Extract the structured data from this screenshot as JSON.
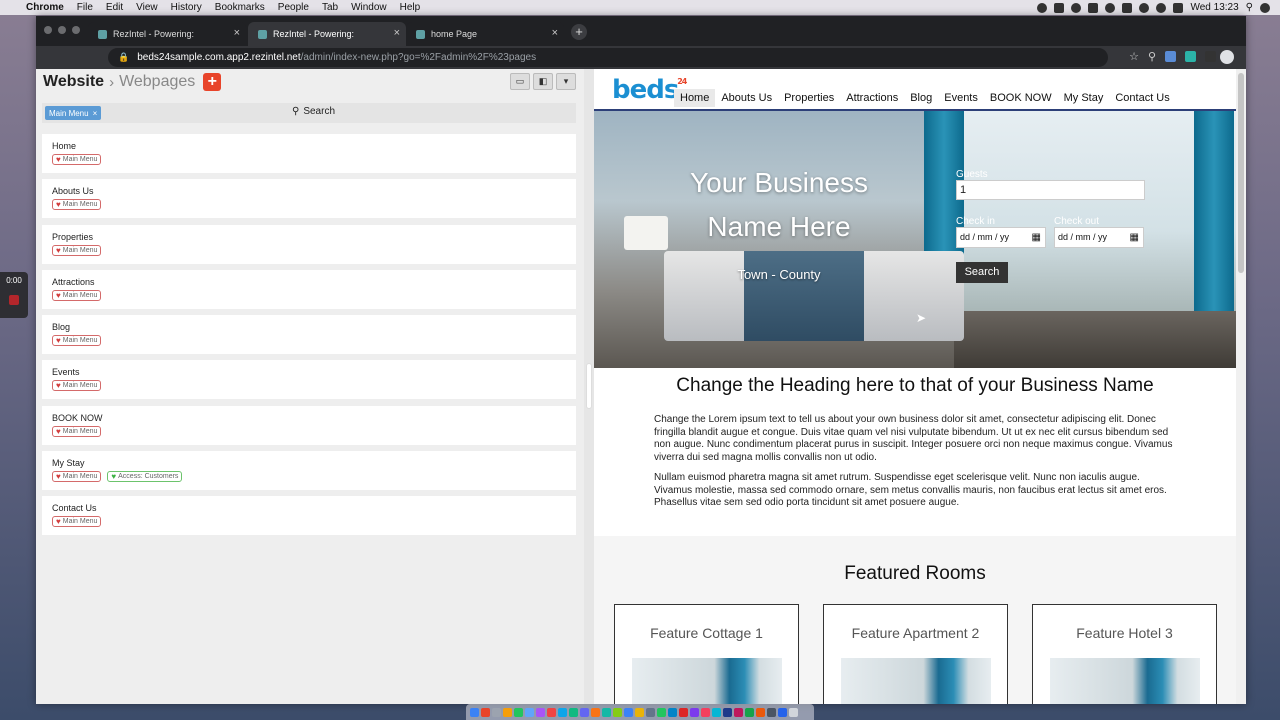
{
  "menubar": {
    "app_name": "Chrome",
    "items": [
      "File",
      "Edit",
      "View",
      "History",
      "Bookmarks",
      "People",
      "Tab",
      "Window",
      "Help"
    ],
    "clock": "Wed 13:23"
  },
  "recorder": {
    "time": "0:00"
  },
  "browser": {
    "tabs": [
      {
        "title": "RezIntel - Powering:"
      },
      {
        "title": "RezIntel - Powering:"
      },
      {
        "title": "home Page"
      }
    ],
    "url_host": "beds24sample.com.app2.rezintel.net",
    "url_path": "/admin/index-new.php?go=%2Fadmin%2F%23pages"
  },
  "admin": {
    "breadcrumb_root": "Website",
    "breadcrumb_current": "Webpages",
    "add_label": "+",
    "filter_chip": "Main Menu",
    "search_label": "Search",
    "pages": [
      {
        "name": "Home",
        "tags": [
          "Main Menu"
        ]
      },
      {
        "name": "Abouts Us",
        "tags": [
          "Main Menu"
        ]
      },
      {
        "name": "Properties",
        "tags": [
          "Main Menu"
        ]
      },
      {
        "name": "Attractions",
        "tags": [
          "Main Menu"
        ]
      },
      {
        "name": "Blog",
        "tags": [
          "Main Menu"
        ]
      },
      {
        "name": "Events",
        "tags": [
          "Main Menu"
        ]
      },
      {
        "name": "BOOK NOW",
        "tags": [
          "Main Menu"
        ]
      },
      {
        "name": "My Stay",
        "tags": [
          "Main Menu",
          "Access: Customers"
        ]
      },
      {
        "name": "Contact Us",
        "tags": [
          "Main Menu"
        ]
      }
    ]
  },
  "site": {
    "logo": "beds",
    "logo_sup": "24",
    "nav": [
      "Home",
      "Abouts Us",
      "Properties",
      "Attractions",
      "Blog",
      "Events",
      "BOOK NOW",
      "My Stay",
      "Contact Us"
    ],
    "hero_title": "Your Business Name Here",
    "hero_subtitle": "Town - County",
    "guests_label": "Guests",
    "guests_value": "1",
    "checkin_label": "Check in",
    "checkout_label": "Check out",
    "date_placeholder": "dd / mm / yy",
    "search_button": "Search",
    "heading": "Change the Heading here to that of your Business Name",
    "para1": "Change the Lorem ipsum text to tell us about your own business dolor sit amet, consectetur adipiscing elit. Donec fringilla blandit augue et congue. Duis vitae quam vel nisi vulputate bibendum. Ut ut ex nec elit cursus bibendum sed non augue. Nunc condimentum placerat purus in suscipit. Integer posuere orci non neque maximus congue. Vivamus viverra dui sed magna mollis convallis non ut odio.",
    "para2": "Nullam euismod pharetra magna sit amet rutrum. Suspendisse eget scelerisque velit. Nunc non iaculis augue. Vivamus molestie, massa sed commodo ornare, sem metus convallis mauris, non faucibus erat lectus sit amet eros. Phasellus vitae sem sed odio porta tincidunt sit amet posuere augue.",
    "featured_heading": "Featured Rooms",
    "rooms": [
      {
        "title": "Feature Cottage 1"
      },
      {
        "title": "Feature Apartment 2"
      },
      {
        "title": "Feature Hotel 3"
      }
    ]
  },
  "colors": {
    "brand_blue": "#1b8fd2",
    "accent_red": "#e8442a",
    "chip_blue": "#5b9bd5",
    "nav_underline": "#2c3f78"
  }
}
